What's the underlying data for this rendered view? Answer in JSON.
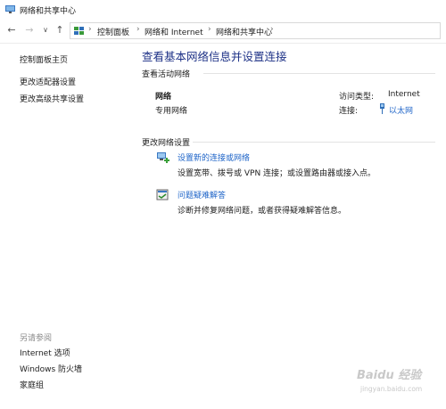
{
  "window": {
    "title": "网络和共享中心"
  },
  "nav": {
    "back": "←",
    "forward": "→",
    "recent": "∨",
    "up": "↑",
    "breadcrumb": [
      "控制面板",
      "网络和 Internet",
      "网络和共享中心"
    ],
    "sep": "›"
  },
  "sidebar": {
    "items": [
      {
        "label": "控制面板主页"
      },
      {
        "label": "更改适配器设置"
      },
      {
        "label": "更改高级共享设置"
      }
    ],
    "see_also_title": "另请参阅",
    "see_also": [
      {
        "label": "Internet 选项"
      },
      {
        "label": "Windows 防火墙"
      },
      {
        "label": "家庭组"
      }
    ]
  },
  "main": {
    "title": "查看基本网络信息并设置连接",
    "active_networks_heading": "查看活动网络",
    "network": {
      "name": "网络",
      "type": "专用网络",
      "access_type_label": "访问类型:",
      "access_type_value": "Internet",
      "connection_label": "连接:",
      "connection_value": "以太网"
    },
    "change_settings_heading": "更改网络设置",
    "tasks": [
      {
        "link": "设置新的连接或网络",
        "desc": "设置宽带、拨号或 VPN 连接；或设置路由器或接入点。",
        "icon": "network-setup-icon"
      },
      {
        "link": "问题疑难解答",
        "desc": "诊断并修复网络问题，或者获得疑难解答信息。",
        "icon": "troubleshoot-icon"
      }
    ]
  },
  "watermark": {
    "brand": "Baidu 经验",
    "site": "jingyan.baidu.com"
  },
  "colors": {
    "link": "#1e64c8",
    "title": "#1e3287",
    "muted": "#8a8a8a"
  }
}
